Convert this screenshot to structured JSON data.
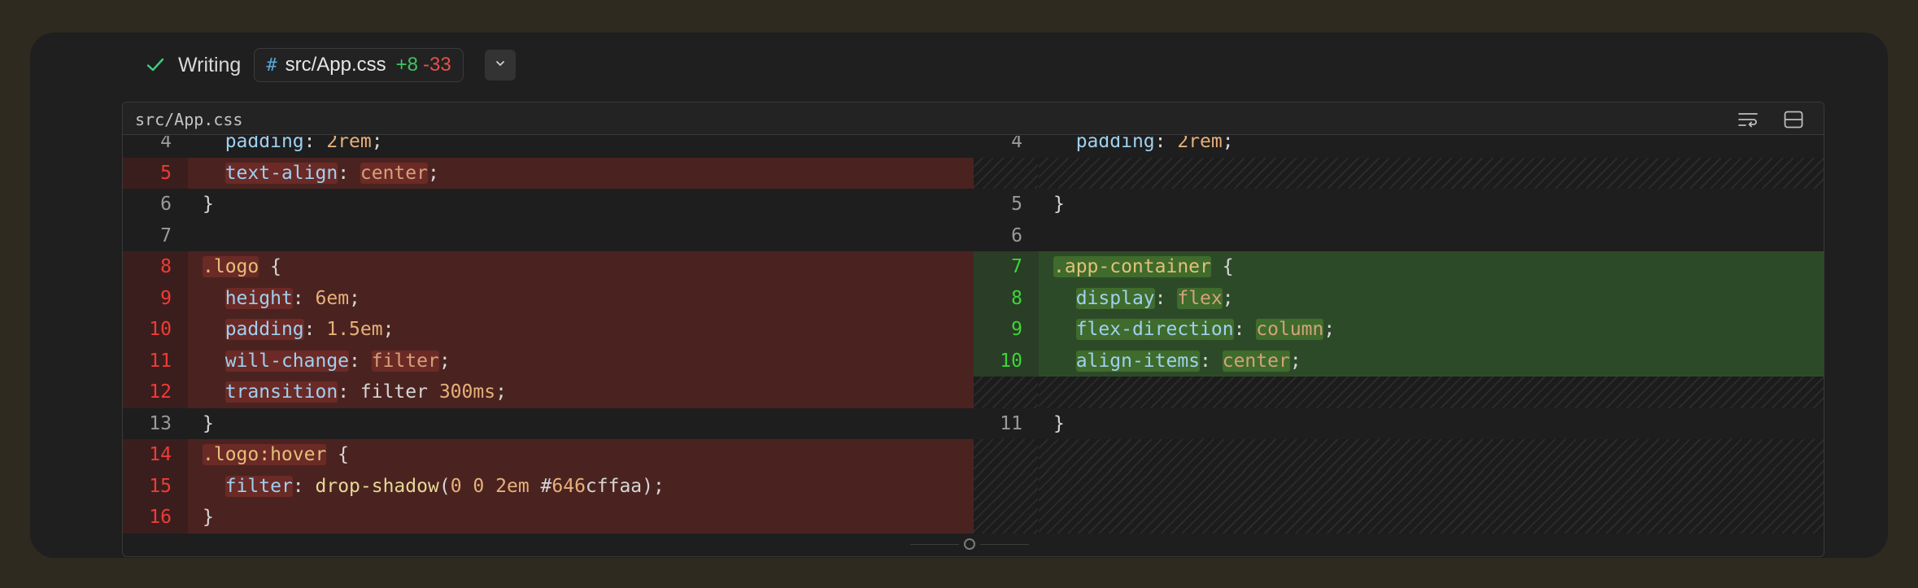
{
  "header": {
    "status_label": "Writing",
    "file_icon": "#",
    "file_name": "src/App.css",
    "additions": "+8",
    "deletions": "-33"
  },
  "diff": {
    "title": "src/App.css",
    "left_rows": [
      {
        "type": "ctx",
        "num": "4",
        "code": "  padding: 2rem;"
      },
      {
        "type": "del",
        "num": "5",
        "code": "  text-align: center;"
      },
      {
        "type": "ctx",
        "num": "6",
        "code": "}"
      },
      {
        "type": "ctx",
        "num": "7",
        "code": ""
      },
      {
        "type": "del",
        "num": "8",
        "code": ".logo {"
      },
      {
        "type": "del",
        "num": "9",
        "code": "  height: 6em;"
      },
      {
        "type": "del",
        "num": "10",
        "code": "  padding: 1.5em;"
      },
      {
        "type": "del",
        "num": "11",
        "code": "  will-change: filter;"
      },
      {
        "type": "del",
        "num": "12",
        "code": "  transition: filter 300ms;"
      },
      {
        "type": "ctx",
        "num": "13",
        "code": "}"
      },
      {
        "type": "del",
        "num": "14",
        "code": ".logo:hover {"
      },
      {
        "type": "del",
        "num": "15",
        "code": "  filter: drop-shadow(0 0 2em #646cffaa);"
      },
      {
        "type": "del",
        "num": "16",
        "code": "}"
      }
    ],
    "right_rows": [
      {
        "type": "ctx",
        "num": "4",
        "code": "  padding: 2rem;"
      },
      {
        "type": "empty",
        "num": "",
        "code": ""
      },
      {
        "type": "ctx",
        "num": "5",
        "code": "}"
      },
      {
        "type": "ctx",
        "num": "6",
        "code": ""
      },
      {
        "type": "add",
        "num": "7",
        "code": ".app-container {"
      },
      {
        "type": "add",
        "num": "8",
        "code": "  display: flex;"
      },
      {
        "type": "add",
        "num": "9",
        "code": "  flex-direction: column;"
      },
      {
        "type": "add",
        "num": "10",
        "code": "  align-items: center;"
      },
      {
        "type": "empty",
        "num": "",
        "code": ""
      },
      {
        "type": "ctx",
        "num": "11",
        "code": "}"
      },
      {
        "type": "empty",
        "num": "",
        "code": ""
      },
      {
        "type": "empty",
        "num": "",
        "code": ""
      },
      {
        "type": "empty",
        "num": "",
        "code": ""
      }
    ]
  },
  "icons": {
    "status": "check-icon",
    "expand": "chevron-down-icon",
    "wrap": "wrap-lines-icon",
    "split": "split-view-icon"
  },
  "colors": {
    "added": "#3fc460",
    "removed": "#e0524e",
    "check": "#3ecf7e"
  }
}
